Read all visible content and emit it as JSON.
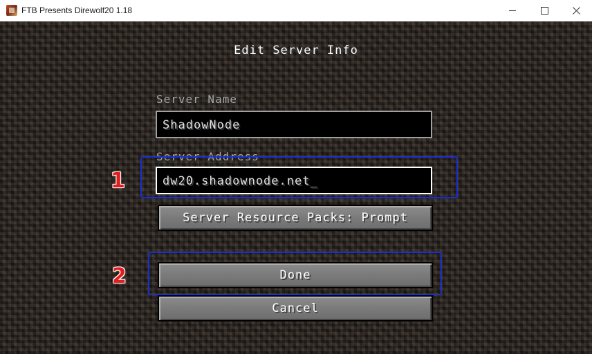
{
  "window": {
    "title": "FTB Presents Direwolf20 1.18",
    "icon": "app-icon"
  },
  "screen": {
    "title": "Edit Server Info"
  },
  "server_name": {
    "label": "Server Name",
    "value": "ShadowNode"
  },
  "server_address": {
    "label": "Server Address",
    "value": "dw20.shadownode.net_"
  },
  "buttons": {
    "resource_packs": "Server Resource Packs: Prompt",
    "done": "Done",
    "cancel": "Cancel"
  },
  "annotations": {
    "step1": "1",
    "step2": "2",
    "box_color": "#1b2fd0",
    "number_color": "#e21d1d"
  }
}
